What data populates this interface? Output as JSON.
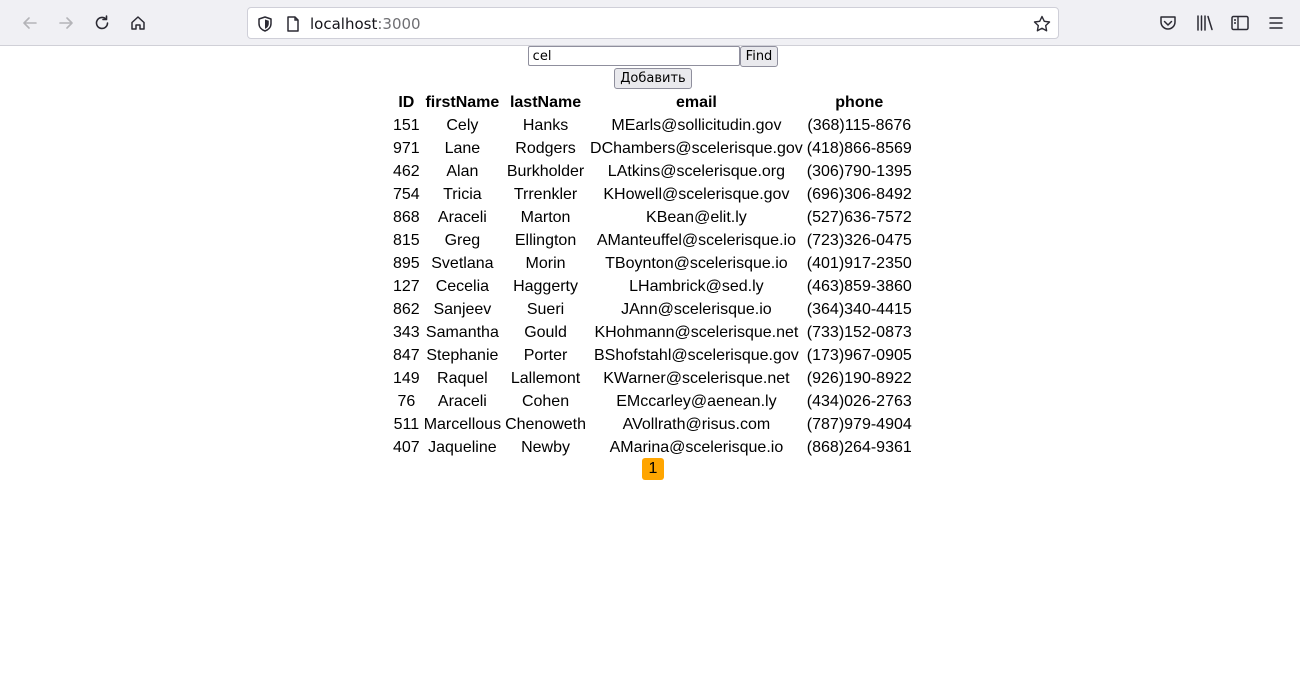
{
  "browser": {
    "url_host": "localhost",
    "url_port": ":3000"
  },
  "search": {
    "value": "cel",
    "find_label": "Find",
    "add_label": "Добавить"
  },
  "table": {
    "headers": [
      "ID",
      "firstName",
      "lastName",
      "email",
      "phone"
    ],
    "rows": [
      [
        "151",
        "Cely",
        "Hanks",
        "MEarls@sollicitudin.gov",
        "(368)115-8676"
      ],
      [
        "971",
        "Lane",
        "Rodgers",
        "DChambers@scelerisque.gov",
        "(418)866-8569"
      ],
      [
        "462",
        "Alan",
        "Burkholder",
        "LAtkins@scelerisque.org",
        "(306)790-1395"
      ],
      [
        "754",
        "Tricia",
        "Trrenkler",
        "KHowell@scelerisque.gov",
        "(696)306-8492"
      ],
      [
        "868",
        "Araceli",
        "Marton",
        "KBean@elit.ly",
        "(527)636-7572"
      ],
      [
        "815",
        "Greg",
        "Ellington",
        "AManteuffel@scelerisque.io",
        "(723)326-0475"
      ],
      [
        "895",
        "Svetlana",
        "Morin",
        "TBoynton@scelerisque.io",
        "(401)917-2350"
      ],
      [
        "127",
        "Cecelia",
        "Haggerty",
        "LHambrick@sed.ly",
        "(463)859-3860"
      ],
      [
        "862",
        "Sanjeev",
        "Sueri",
        "JAnn@scelerisque.io",
        "(364)340-4415"
      ],
      [
        "343",
        "Samantha",
        "Gould",
        "KHohmann@scelerisque.net",
        "(733)152-0873"
      ],
      [
        "847",
        "Stephanie",
        "Porter",
        "BShofstahl@scelerisque.gov",
        "(173)967-0905"
      ],
      [
        "149",
        "Raquel",
        "Lallemont",
        "KWarner@scelerisque.net",
        "(926)190-8922"
      ],
      [
        "76",
        "Araceli",
        "Cohen",
        "EMccarley@aenean.ly",
        "(434)026-2763"
      ],
      [
        "511",
        "Marcellous",
        "Chenoweth",
        "AVollrath@risus.com",
        "(787)979-4904"
      ],
      [
        "407",
        "Jaqueline",
        "Newby",
        "AMarina@scelerisque.io",
        "(868)264-9361"
      ]
    ]
  },
  "pagination": {
    "current_page": "1",
    "accent": "#ffa500"
  }
}
